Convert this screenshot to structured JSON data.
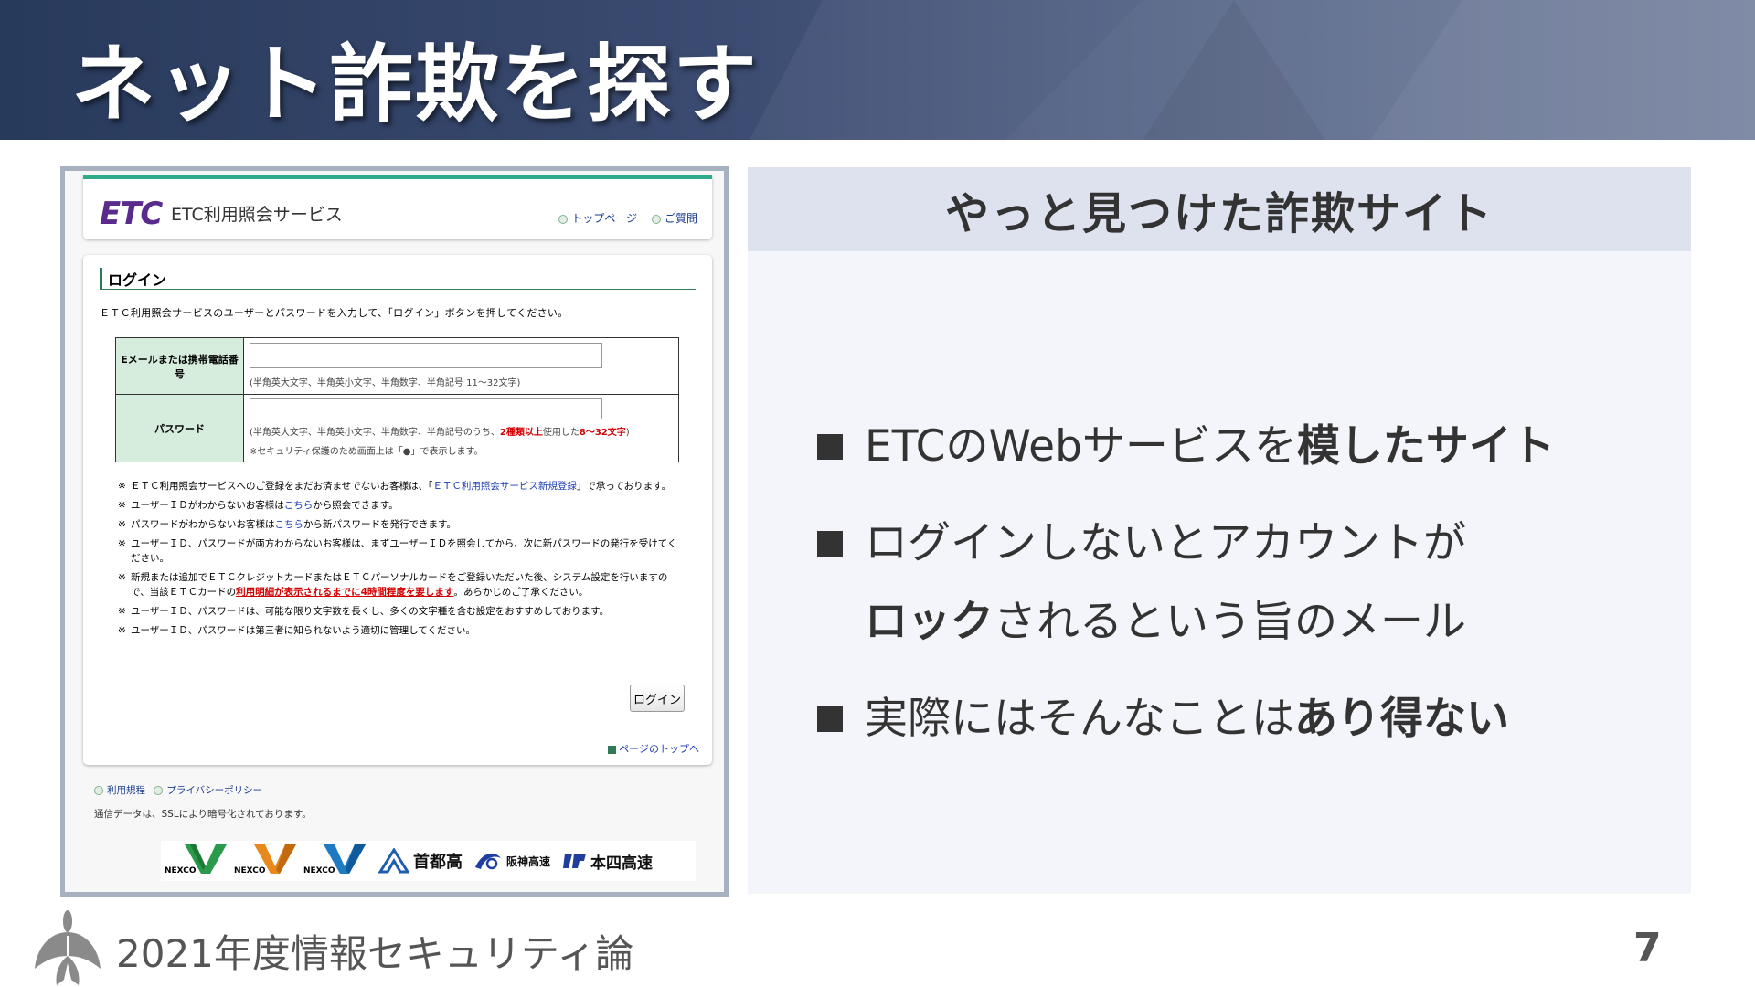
{
  "slide": {
    "title": "ネット詐欺を探す",
    "course": "2021年度情報セキュリティ論",
    "page_number": "7"
  },
  "screenshot": {
    "logo": "ETC",
    "service_name": "ETC利用照会サービス",
    "nav": [
      "トップページ",
      "ご質問"
    ],
    "login": {
      "heading": "ログイン",
      "intro": "ＥＴＣ利用照会サービスのユーザーとパスワードを入力して、「ログイン」ボタンを押してください。",
      "email_label": "Eメールまたは携帯電話番号",
      "email_value": "",
      "email_hint": "(半角英大文字、半角英小文字、半角数字、半角記号 11～32文字)",
      "password_label": "パスワード",
      "password_value": "",
      "password_hint_pre": "(半角英大文字、半角英小文字、半角数字、半角記号のうち、",
      "password_hint_red1": "2種類以上",
      "password_hint_mid": "使用した",
      "password_hint_red2": "8～32文字",
      "password_hint_post": ")",
      "password_note": "※セキュリティ保護のため画面上は「●」で表示します。",
      "notes": [
        {
          "mark": "※",
          "pre": "ＥＴＣ利用照会サービスへのご登録をまだお済ませでないお客様は、「",
          "link": "ＥＴＣ利用照会サービス新規登録",
          "post": "」で承っております。"
        },
        {
          "mark": "※",
          "pre": "ユーザーＩＤがわからないお客様は",
          "link": "こちら",
          "post": "から照会できます。"
        },
        {
          "mark": "※",
          "pre": "パスワードがわからないお客様は",
          "link": "こちら",
          "post": "から新パスワードを発行できます。"
        },
        {
          "mark": "※",
          "pre": "ユーザーＩＤ、パスワードが両方わからないお客様は、まずユーザーＩＤを照会してから、次に新パスワードの発行を受けてください。",
          "link": "",
          "post": ""
        },
        {
          "mark": "※",
          "pre": "新規または追加でＥＴＣクレジットカードまたはＥＴＣパーソナルカードをご登録いただいた後、システム設定を行いますので、当該ＥＴＣカードの",
          "red": "利用明細が表示されるまでに4時間程度を要します",
          "post": "。あらかじめご了承ください。"
        },
        {
          "mark": "※",
          "pre": "ユーザーＩＤ、パスワードは、可能な限り文字数を長くし、多くの文字種を含む設定をおすすめしております。",
          "link": "",
          "post": ""
        },
        {
          "mark": "※",
          "pre": "ユーザーＩＤ、パスワードは第三者に知られないよう適切に管理してください。",
          "link": "",
          "post": ""
        }
      ],
      "button_label": "ログイン",
      "page_top": "ページのトップへ"
    },
    "footer_links": [
      "利用規程",
      "プライバシーポリシー"
    ],
    "ssl_note": "通信データは、SSLにより暗号化されております。",
    "partner_logos": [
      "NEXCO",
      "NEXCO",
      "NEXCO",
      "首都高",
      "阪神高速",
      "本四高速"
    ]
  },
  "panel": {
    "heading": "やっと見つけた詐欺サイト",
    "bullets": [
      {
        "normal": "ETCのWebサービスを",
        "bold": "模したサイト"
      },
      {
        "line1": "ログインしないとアカウントが",
        "bold": "ロック",
        "normal2": "されるという旨のメール"
      },
      {
        "normal": "実際にはそんなことは",
        "bold": "あり得ない"
      }
    ]
  },
  "colors": {
    "header_bg": "#2f4065",
    "etc_purple": "#5a2a8c",
    "form_label_bg": "#d6ecdc",
    "panel_bg": "#f4f5fa",
    "panel_head_bg": "#dde2ee",
    "warning_red": "#d40000"
  }
}
